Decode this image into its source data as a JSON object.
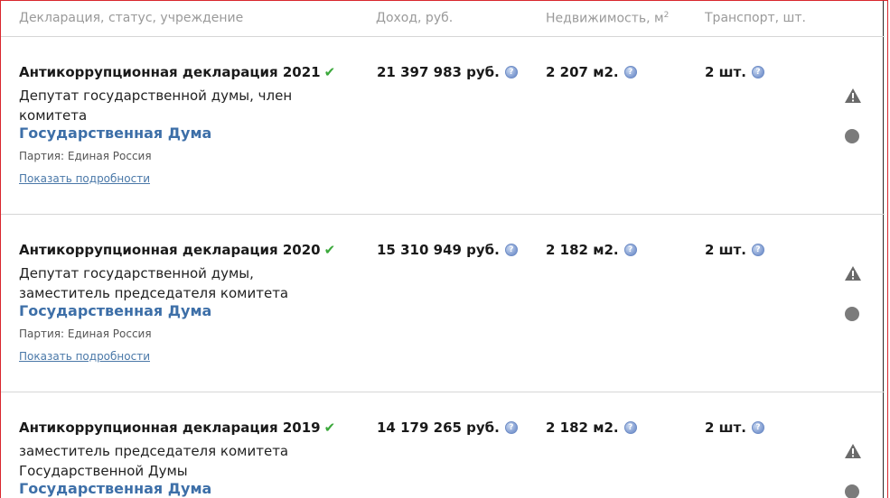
{
  "header": {
    "declaration_col": "Декларация, статус, учреждение",
    "income_col": "Доход, руб.",
    "realty_col": "Недвижимость, м",
    "realty_sup": "2",
    "transport_col": "Транспорт, шт."
  },
  "rows": [
    {
      "title": "Антикоррупционная декларация 2021",
      "check": "✔",
      "position": "Депутат государственной думы, член комитета",
      "org": "Государственная Дума",
      "party": "Партия: Единая Россия",
      "details": "Показать подробности",
      "income": "21 397 983 руб.",
      "realty": "2 207 м2.",
      "transport": "2 шт."
    },
    {
      "title": "Антикоррупционная декларация 2020",
      "check": "✔",
      "position": "Депутат государственной думы, заместитель председателя комитета",
      "org": "Государственная Дума",
      "party": "Партия: Единая Россия",
      "details": "Показать подробности",
      "income": "15 310 949 руб.",
      "realty": "2 182 м2.",
      "transport": "2 шт."
    },
    {
      "title": "Антикоррупционная декларация 2019",
      "check": "✔",
      "position": "заместитель председателя комитета Государственной Думы",
      "org": "Государственная Дума",
      "income": "14 179 265 руб.",
      "realty": "2 182 м2.",
      "transport": "2 шт."
    }
  ],
  "icons": {
    "help": "question-circle-icon",
    "warning": "warning-triangle-icon",
    "status": "status-dot-icon",
    "check": "checkmark-icon"
  },
  "colors": {
    "org_link": "#3d6fa8",
    "check": "#3aa83a",
    "frame": "#d9272e"
  }
}
